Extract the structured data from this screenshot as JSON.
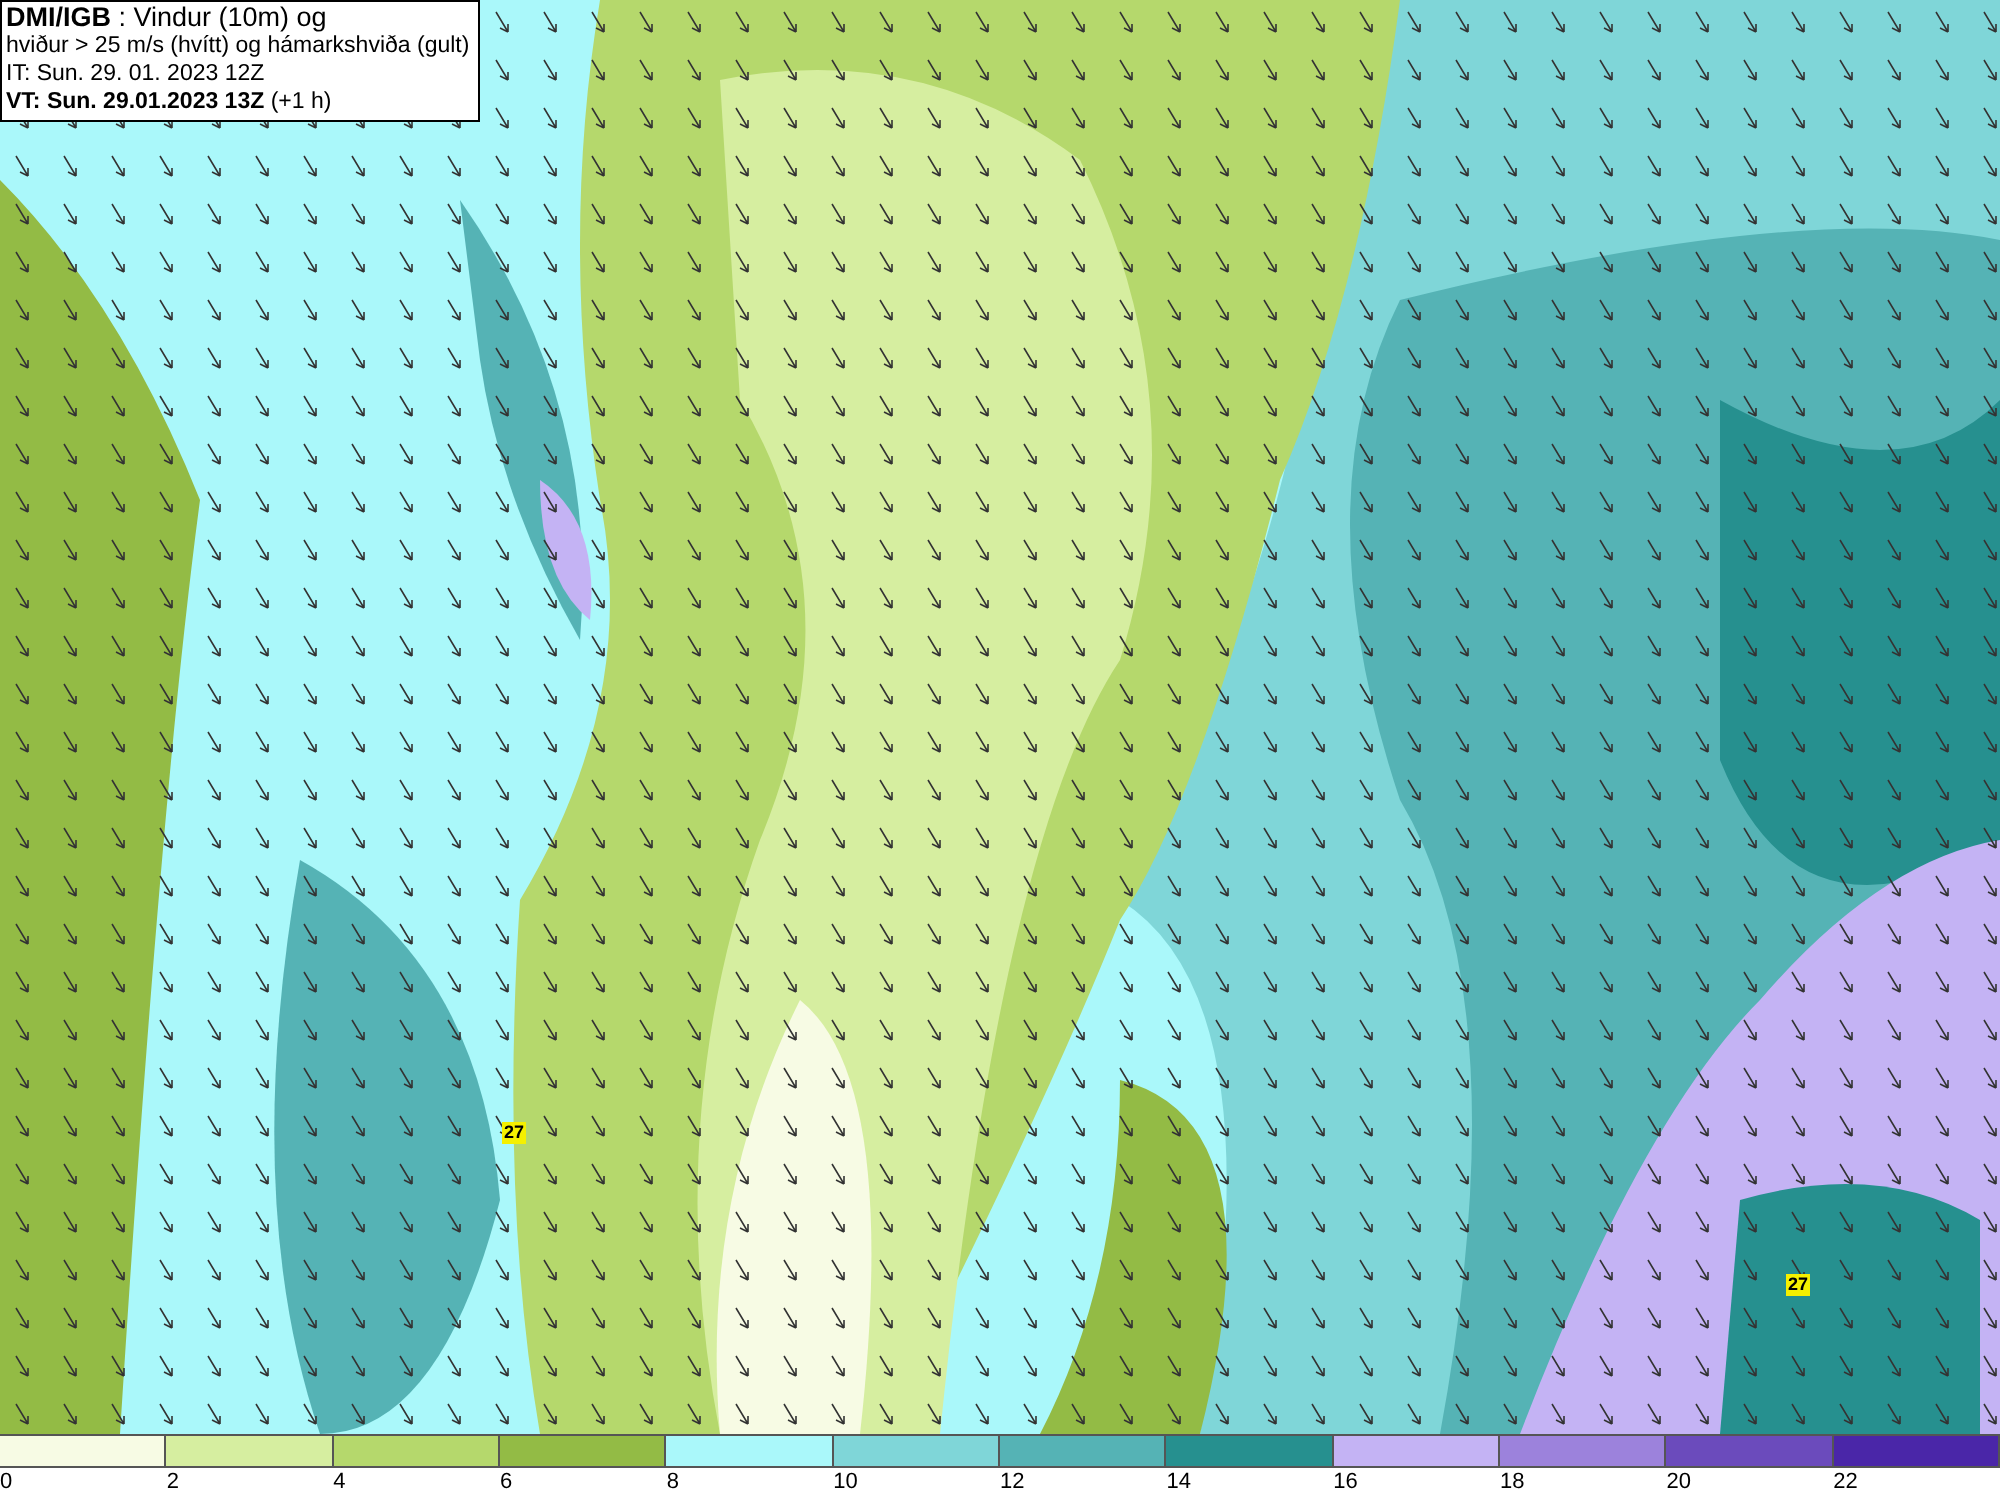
{
  "title_box": {
    "lines": [
      "**DMI/IGB** : Vindur (10m) og",
      "hviður > 25 m/s (hvítt) og hámarkshviða (gult)",
      "IT: Sun. 29. 01. 2023 12Z",
      "**VT: Sun. 29.01.2023 13Z** (+1 h)"
    ]
  },
  "map": {
    "gust_labels": [
      "27",
      "27"
    ]
  },
  "legend": {
    "items": [
      {
        "label": "0",
        "color": "#f7fbe4"
      },
      {
        "label": "2",
        "color": "#d6eea0"
      },
      {
        "label": "4",
        "color": "#b5d86c"
      },
      {
        "label": "6",
        "color": "#93bb45"
      },
      {
        "label": "8",
        "color": "#aaf8fa"
      },
      {
        "label": "10",
        "color": "#7fd6d8"
      },
      {
        "label": "12",
        "color": "#55b3b5"
      },
      {
        "label": "14",
        "color": "#26908f"
      },
      {
        "label": "16",
        "color": "#c4b3f4"
      },
      {
        "label": "18",
        "color": "#9c82dc"
      },
      {
        "label": "20",
        "color": "#6b4bbc"
      },
      {
        "label": "22",
        "color": "#4a26a8"
      }
    ]
  }
}
